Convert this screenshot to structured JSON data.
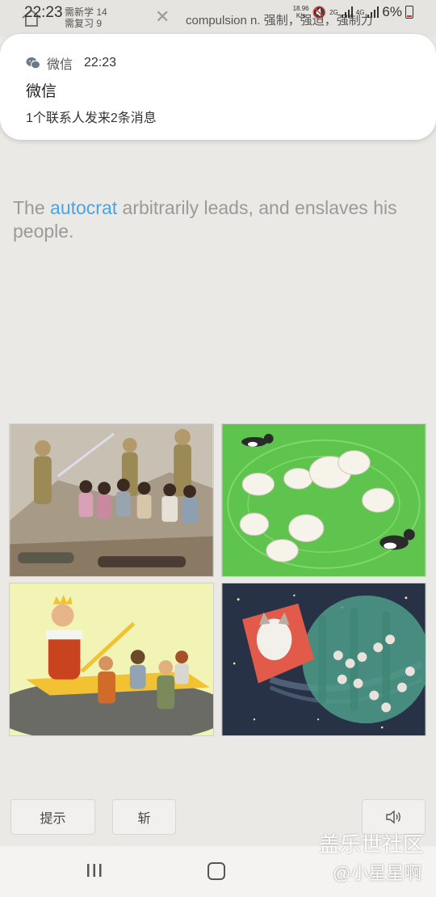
{
  "status_bar": {
    "time": "22:23",
    "net_speed_value": "18.96",
    "net_speed_unit": "K/s",
    "net_2g": "2G",
    "net_4g": "4G",
    "battery": "6%"
  },
  "app_bar": {
    "progress_learn": "需新学 14",
    "progress_review": "需复习 9",
    "word_text": "compulsion n. 强制，强迫，强制力"
  },
  "notification": {
    "app_name": "微信",
    "time": "22:23",
    "title": "微信",
    "body": "1个联系人发来2条消息"
  },
  "sentence": {
    "before": "The ",
    "highlight": "autocrat",
    "after": " arbitrarily leads, and enslaves his people."
  },
  "options": [
    {
      "id": "soldiers-captives-picture"
    },
    {
      "id": "dogs-herding-sheep-picture"
    },
    {
      "id": "king-on-palanquin-picture"
    },
    {
      "id": "cat-leading-cats-space-picture"
    }
  ],
  "buttons": {
    "hint": "提示",
    "kill": "斩",
    "sound_icon": "speaker-icon"
  },
  "watermark": {
    "line1": "盖乐世社区",
    "line2": "@小星星啊"
  },
  "colors": {
    "highlight": "#4aa3e6",
    "background": "#ebe9e6"
  }
}
